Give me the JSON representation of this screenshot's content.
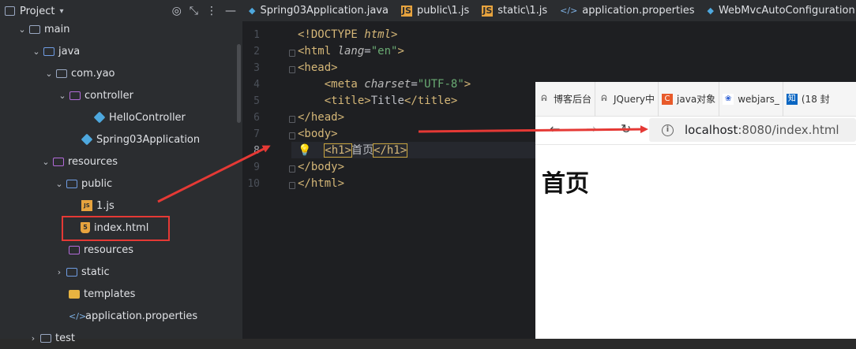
{
  "project": {
    "title": "Project",
    "tree": [
      {
        "label": "main",
        "icon": "folder-icon",
        "expanded": true
      },
      {
        "label": "java",
        "icon": "folder-source-icon",
        "expanded": true
      },
      {
        "label": "com.yao",
        "icon": "package-icon",
        "expanded": true
      },
      {
        "label": "controller",
        "icon": "package-icon",
        "expanded": true
      },
      {
        "label": "HelloController",
        "icon": "class-icon"
      },
      {
        "label": "Spring03Application",
        "icon": "spring-class-icon"
      },
      {
        "label": "resources",
        "icon": "resources-folder-icon",
        "expanded": true
      },
      {
        "label": "public",
        "icon": "folder-icon",
        "expanded": true
      },
      {
        "label": "1.js",
        "icon": "js-file-icon"
      },
      {
        "label": "index.html",
        "icon": "html5-file-icon",
        "selected": true
      },
      {
        "label": "resources",
        "icon": "resources-folder-icon"
      },
      {
        "label": "static",
        "icon": "folder-icon",
        "expanded": false
      },
      {
        "label": "templates",
        "icon": "folder-icon"
      },
      {
        "label": "application.properties",
        "icon": "properties-file-icon"
      },
      {
        "label": "test",
        "icon": "folder-icon",
        "expanded": false
      }
    ]
  },
  "tabs": [
    {
      "label": "Spring03Application.java",
      "icon": "spring-class-icon"
    },
    {
      "label": "public\\1.js",
      "icon": "js-file-icon"
    },
    {
      "label": "static\\1.js",
      "icon": "js-file-icon"
    },
    {
      "label": "application.properties",
      "icon": "properties-file-icon"
    },
    {
      "label": "WebMvcAutoConfiguration.j",
      "icon": "class-icon"
    }
  ],
  "editor": {
    "line_numbers": [
      "1",
      "2",
      "3",
      "4",
      "5",
      "6",
      "7",
      "8",
      "9",
      "10"
    ],
    "current_line": "8",
    "lines": {
      "l1": {
        "open": "<!DOCTYPE ",
        "kw": "html",
        "close": ">"
      },
      "l2": {
        "open": "<html ",
        "attr": "lang",
        "eq": "=",
        "val": "\"en\"",
        "close": ">"
      },
      "l3": {
        "text": "<head>"
      },
      "l4": {
        "open": "    <meta ",
        "attr": "charset",
        "eq": "=",
        "val": "\"UTF-8\"",
        "close": ">"
      },
      "l5": {
        "indent": "    ",
        "otag": "<title>",
        "text": "Title",
        "ctag": "</title>"
      },
      "l6": {
        "text": "</head>"
      },
      "l7": {
        "text": "<body>"
      },
      "l8": {
        "otag": "<h1>",
        "text": "首页",
        "ctag": "</h1>"
      },
      "l9": {
        "text": "</body>"
      },
      "l10": {
        "text": "</html>"
      }
    }
  },
  "browser": {
    "bookmarks": [
      {
        "label": "博客后台",
        "icon": "bookmark-icon"
      },
      {
        "label": "JQuery中",
        "icon": "bookmark-icon"
      },
      {
        "label": "java对象",
        "icon": "c-icon"
      },
      {
        "label": "webjars_",
        "icon": "paw-icon"
      },
      {
        "label": "(18 封",
        "icon": "zhi-icon"
      }
    ],
    "url_host": "localhost",
    "url_rest": ":8080/index.html",
    "page_heading": "首页"
  }
}
